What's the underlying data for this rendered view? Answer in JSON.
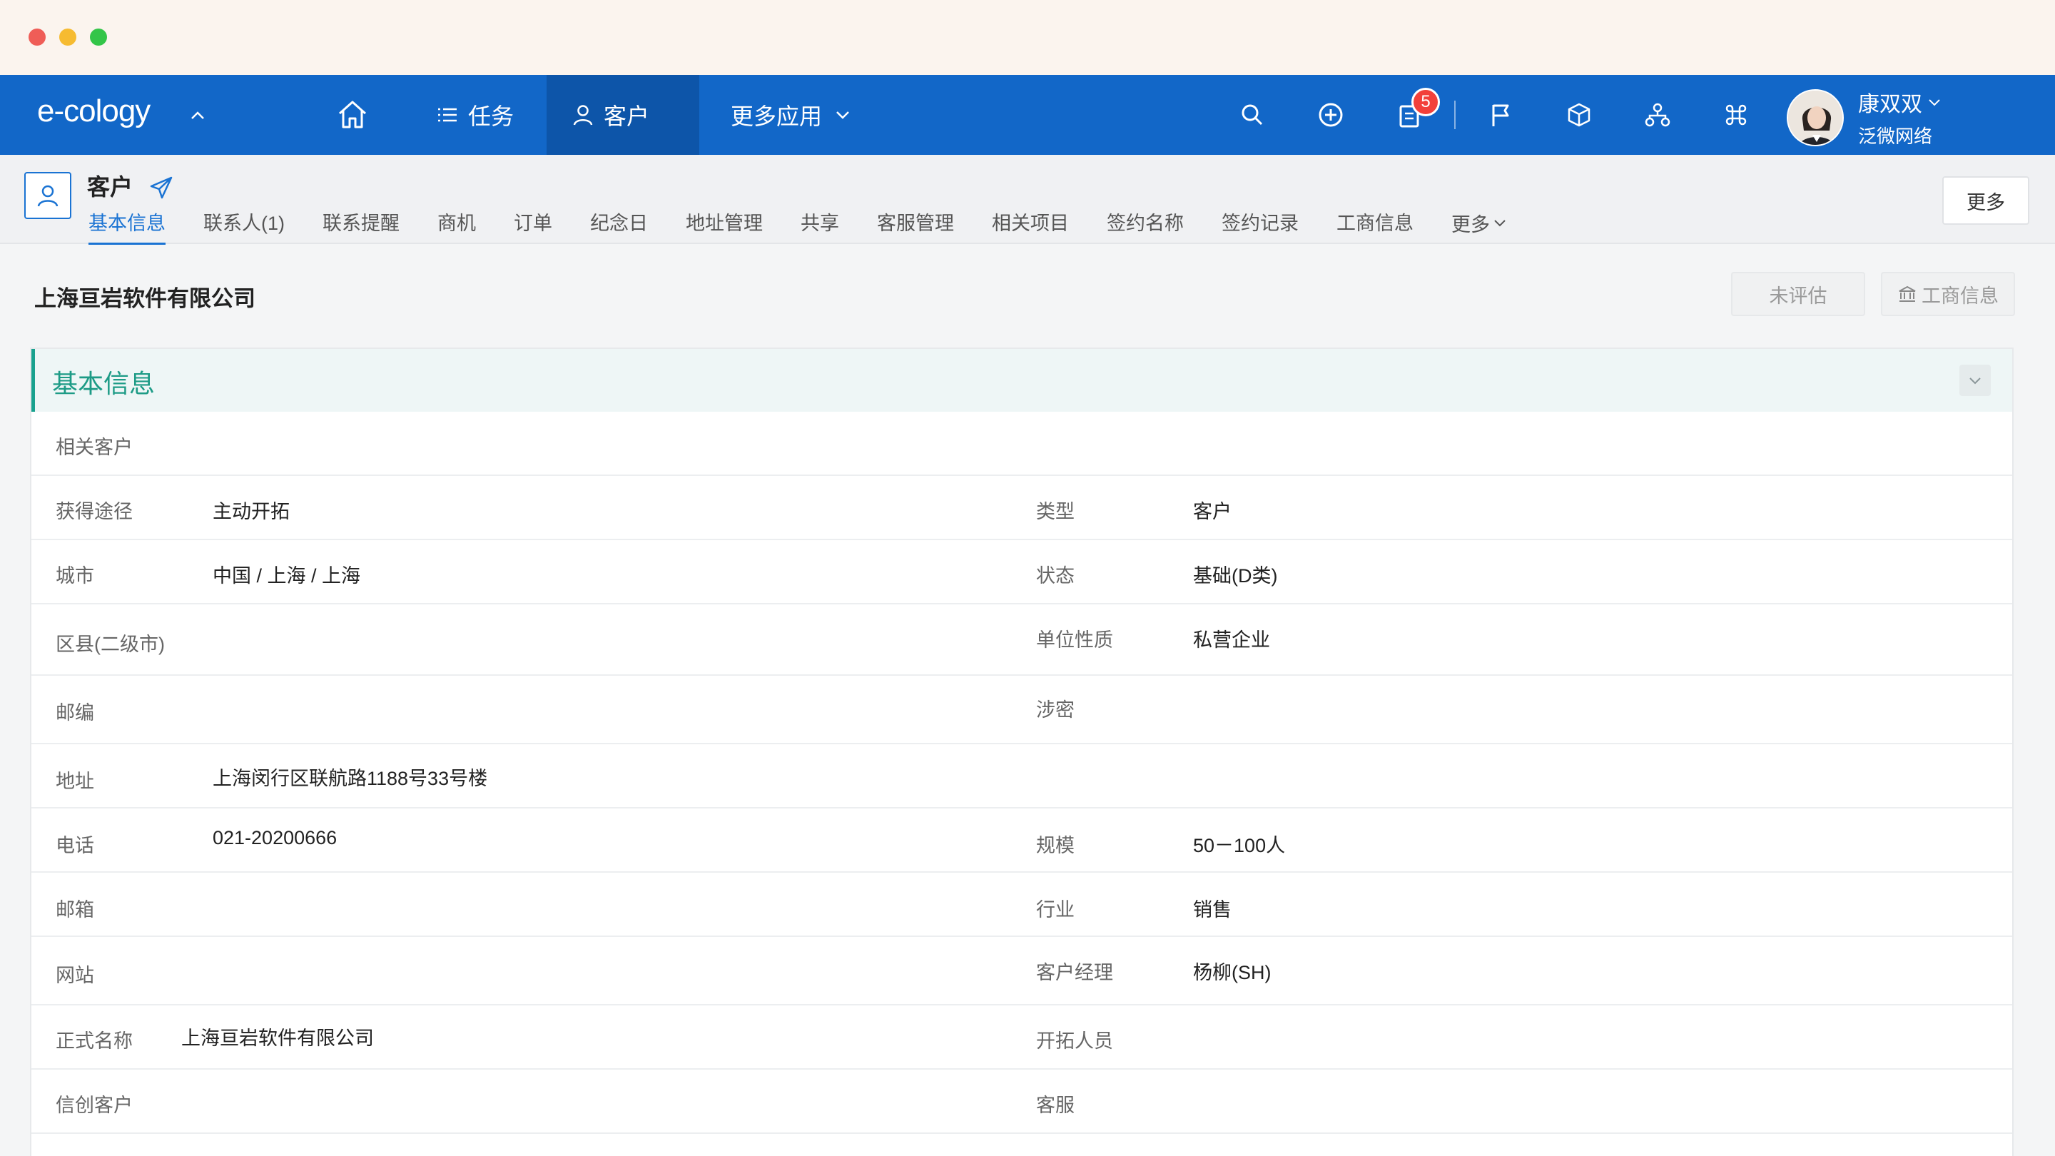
{
  "app": {
    "logo": "e-cology"
  },
  "nav": {
    "task_label": "任务",
    "customer_label": "客户",
    "more_apps_label": "更多应用",
    "notification_count": "5"
  },
  "user": {
    "name": "康双双",
    "org": "泛微网络"
  },
  "object": {
    "title": "客户"
  },
  "tabs": [
    "基本信息",
    "联系人(1)",
    "联系提醒",
    "商机",
    "订单",
    "纪念日",
    "地址管理",
    "共享",
    "客服管理",
    "相关项目",
    "签约名称",
    "签约记录",
    "工商信息",
    "更多"
  ],
  "header_more_button": "更多",
  "company": {
    "name": "上海亘岩软件有限公司"
  },
  "actions": {
    "unrated": "未评估",
    "business_info": "工商信息"
  },
  "section": {
    "title": "基本信息"
  },
  "fields": {
    "related_customer": {
      "label": "相关客户",
      "value": ""
    },
    "source": {
      "label": "获得途径",
      "value": "主动开拓"
    },
    "type": {
      "label": "类型",
      "value": "客户"
    },
    "city": {
      "label": "城市",
      "value": "中国 / 上海 / 上海"
    },
    "status": {
      "label": "状态",
      "value": "基础(D类)"
    },
    "district": {
      "label": "区县(二级市)",
      "value": ""
    },
    "unit_nature": {
      "label": "单位性质",
      "value": "私营企业"
    },
    "postcode": {
      "label": "邮编",
      "value": ""
    },
    "classified": {
      "label": "涉密",
      "value": ""
    },
    "address": {
      "label": "地址",
      "value": "上海闵行区联航路1188号33号楼"
    },
    "phone": {
      "label": "电话",
      "value": "021-20200666"
    },
    "scale": {
      "label": "规模",
      "value": "50－100人"
    },
    "email": {
      "label": "邮箱",
      "value": ""
    },
    "industry": {
      "label": "行业",
      "value": "销售"
    },
    "website": {
      "label": "网站",
      "value": ""
    },
    "manager": {
      "label": "客户经理",
      "value": "杨柳(SH)"
    },
    "official_name": {
      "label": "正式名称",
      "value": "上海亘岩软件有限公司"
    },
    "developer": {
      "label": "开拓人员",
      "value": ""
    },
    "xinchuang": {
      "label": "信创客户",
      "value": ""
    },
    "service": {
      "label": "客服",
      "value": ""
    }
  }
}
